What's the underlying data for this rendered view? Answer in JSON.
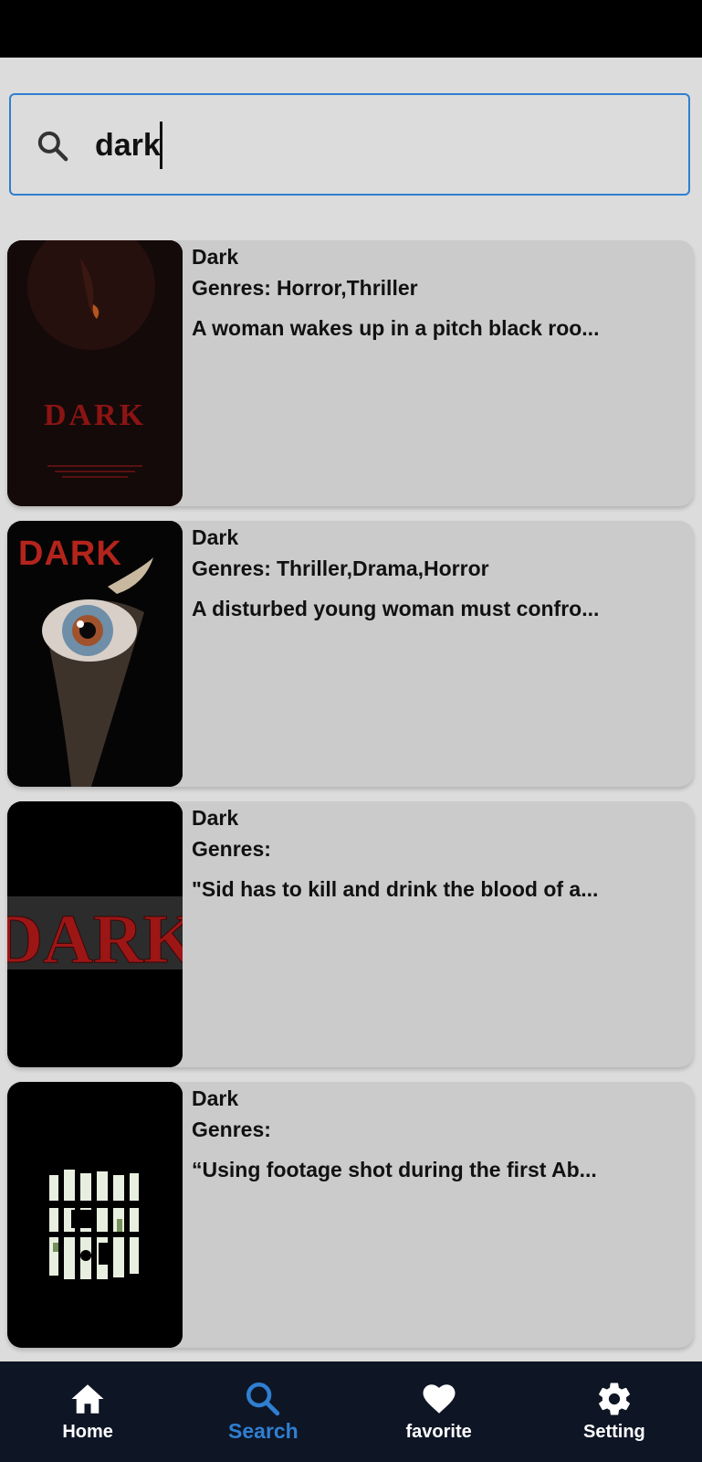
{
  "search": {
    "value": "dark",
    "placeholder": ""
  },
  "results": [
    {
      "title": "Dark",
      "genres_label": "Genres:",
      "genres": "Horror,Thriller",
      "description": "A woman wakes up in a pitch black roo...",
      "poster_text": "DARK"
    },
    {
      "title": "Dark",
      "genres_label": "Genres:",
      "genres": "Thriller,Drama,Horror",
      "description": "A disturbed young woman must confro...",
      "poster_text": "DARK"
    },
    {
      "title": "Dark",
      "genres_label": "Genres:",
      "genres": "",
      "description": "\"Sid has to kill and drink the blood of a...",
      "poster_text": "DARK"
    },
    {
      "title": "Dark",
      "genres_label": "Genres:",
      "genres": "",
      "description": "“Using footage shot during the first Ab...",
      "poster_text": ""
    }
  ],
  "nav": {
    "items": [
      {
        "label": "Home",
        "icon": "home-icon"
      },
      {
        "label": "Search",
        "icon": "search-icon"
      },
      {
        "label": "favorite",
        "icon": "heart-icon"
      },
      {
        "label": "Setting",
        "icon": "gear-icon"
      }
    ],
    "active": "Search"
  },
  "colors": {
    "accent": "#2f7fd1",
    "nav_background": "#0e1525",
    "card_background": "#cbcbcb",
    "page_background": "#dcdcdc",
    "poster_red": "#8b1414"
  }
}
